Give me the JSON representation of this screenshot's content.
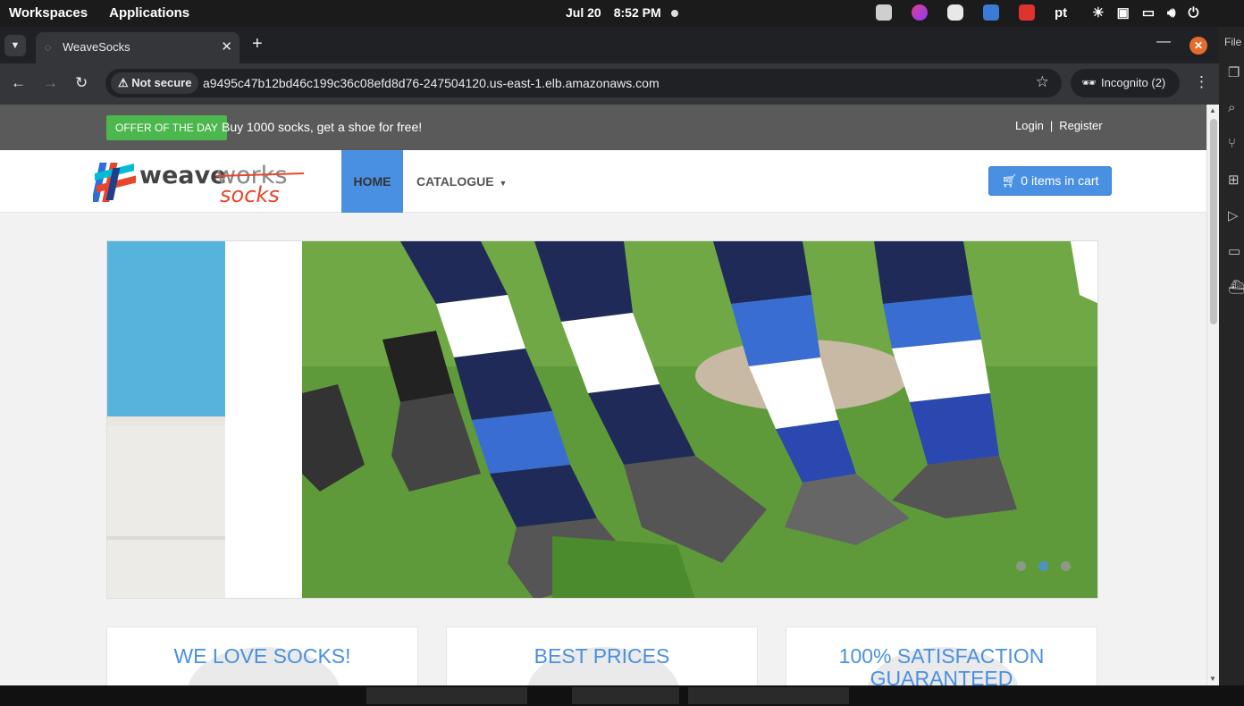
{
  "topbar": {
    "workspaces": "Workspaces",
    "applications": "Applications",
    "date": "Jul 20",
    "time": "8:52 PM",
    "lang": "pt",
    "tray_colors": [
      "#cfcfcf",
      "#8a3cff",
      "#e8e8e8",
      "#3a7bd5",
      "#e0322f"
    ]
  },
  "browser": {
    "tab_title": "WeaveSocks",
    "not_secure": "Not secure",
    "url": "a9495c47b12bd46c199c36c08efd8d76-247504120.us-east-1.elb.amazonaws.com",
    "incognito": "Incognito (2)"
  },
  "page": {
    "offer_badge": "OFFER OF THE DAY",
    "offer_text": "Buy 1000 socks, get a shoe for free!",
    "login": "Login",
    "separator": "|",
    "register": "Register",
    "nav": {
      "home": "HOME",
      "catalogue": "CATALOGUE"
    },
    "cart": "0 items in cart",
    "carousel": {
      "slides": 3,
      "active_index": 1
    },
    "features": [
      {
        "title": "WE LOVE SOCKS!"
      },
      {
        "title": "BEST PRICES"
      },
      {
        "title": "100% SATISFACTION GUARANTEED"
      }
    ],
    "colors": {
      "accent": "#4a90e2",
      "offer_green": "#4cb74c",
      "offer_bar": "#5a5a5a"
    }
  },
  "vscode": {
    "file_label": "File"
  }
}
